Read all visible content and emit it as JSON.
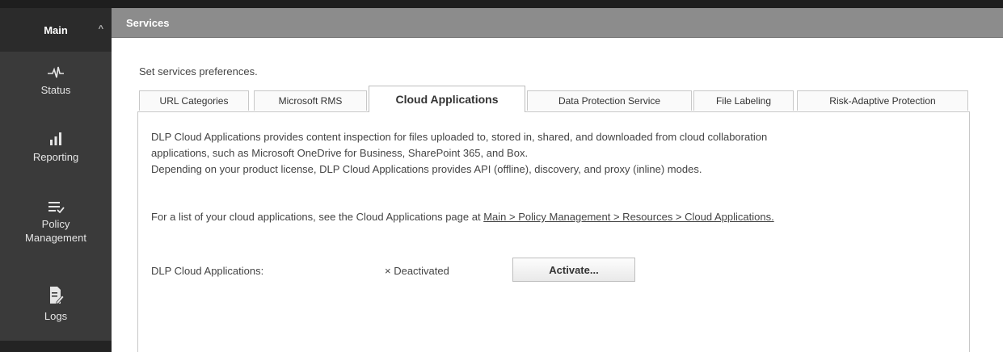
{
  "sidebar": {
    "header": "Main",
    "items": [
      {
        "label": "Status",
        "icon": "pulse-icon"
      },
      {
        "label": "Reporting",
        "icon": "bar-chart-icon"
      },
      {
        "label_line1": "Policy",
        "label_line2": "Management",
        "icon": "list-check-icon"
      },
      {
        "label": "Logs",
        "icon": "log-document-icon"
      }
    ]
  },
  "header": {
    "title": "Services"
  },
  "intro": "Set services preferences.",
  "tabs": [
    {
      "label": "URL Categories"
    },
    {
      "label": "Microsoft RMS"
    },
    {
      "label": "Cloud Applications",
      "active": true
    },
    {
      "label": "Data Protection Service"
    },
    {
      "label": "File Labeling"
    },
    {
      "label": "Risk-Adaptive Protection"
    }
  ],
  "panel": {
    "desc1": "DLP Cloud Applications provides content inspection for files uploaded to, stored in, shared, and downloaded from cloud collaboration",
    "desc2": "applications, such as Microsoft OneDrive for Business, SharePoint 365, and Box.",
    "desc3": "Depending on your product license, DLP Cloud Applications provides API (offline), discovery, and proxy (inline) modes.",
    "list_prefix": "For a list of your cloud applications, see the Cloud Applications page at ",
    "list_link": "Main > Policy Management > Resources > Cloud Applications.",
    "field_label": "DLP Cloud Applications:",
    "status": "× Deactivated",
    "button": "Activate..."
  },
  "colors": {
    "sidebar": "#3a3a3a",
    "header": "#8c8c8c"
  }
}
